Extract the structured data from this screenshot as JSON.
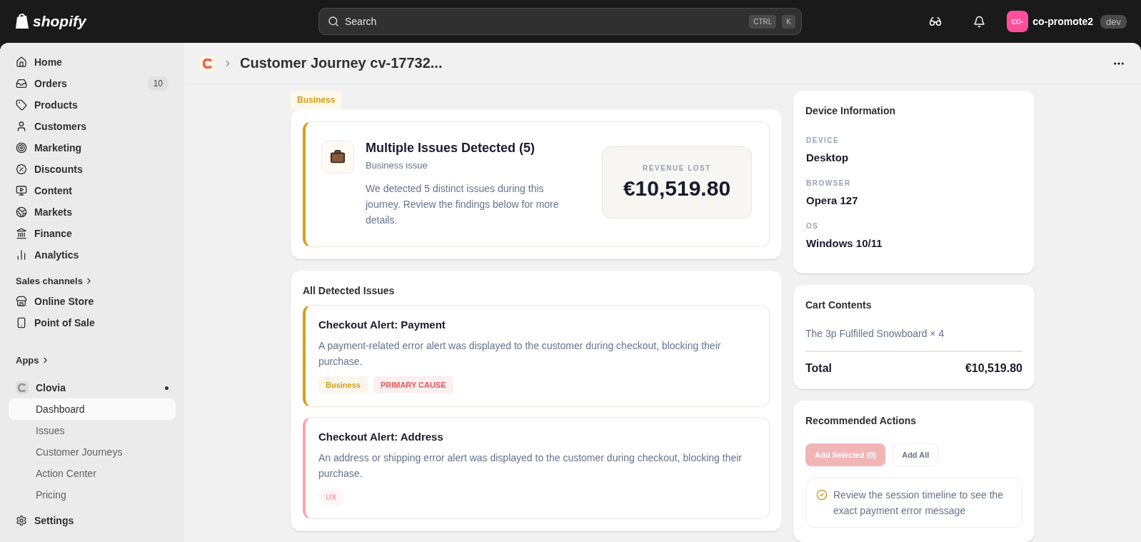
{
  "topbar": {
    "logo": "shopify",
    "search": {
      "placeholder": "Search",
      "keys": [
        "CTRL",
        "K"
      ]
    },
    "avatar": "co-",
    "store": "co-promote2",
    "env": "dev"
  },
  "sidebar": {
    "items": [
      {
        "label": "Home",
        "selected": false
      },
      {
        "label": "Orders",
        "badge": "10",
        "selected": false
      },
      {
        "label": "Products",
        "selected": false
      },
      {
        "label": "Customers",
        "selected": false
      },
      {
        "label": "Marketing",
        "selected": false
      },
      {
        "label": "Discounts",
        "selected": false
      },
      {
        "label": "Content",
        "selected": false
      },
      {
        "label": "Markets",
        "selected": false
      },
      {
        "label": "Finance",
        "selected": false
      },
      {
        "label": "Analytics",
        "selected": false
      }
    ],
    "sales_channels": {
      "heading": "Sales channels",
      "items": [
        {
          "label": "Online Store",
          "selected": false
        },
        {
          "label": "Point of Sale",
          "selected": false
        }
      ]
    },
    "apps": {
      "heading": "Apps",
      "app": {
        "label": "Clovia",
        "children": [
          {
            "label": "Dashboard",
            "selected": true
          },
          {
            "label": "Issues",
            "selected": false
          },
          {
            "label": "Customer Journeys",
            "selected": false
          },
          {
            "label": "Action Center",
            "selected": false
          },
          {
            "label": "Pricing",
            "selected": false
          }
        ]
      }
    },
    "settings": {
      "label": "Settings",
      "selected": false
    }
  },
  "page": {
    "title": "Customer Journey cv-17732..."
  },
  "summary": {
    "category": "Business",
    "color": "#d4a017",
    "title": "Multiple Issues Detected (5)",
    "subtitle": "Business issue",
    "text": "We detected 5 distinct issues during this journey. Review the findings below for more details.",
    "revenue_label": "REVENUE LOST",
    "revenue": "€10,519.80"
  },
  "issues": {
    "heading": "All Detected Issues",
    "items": [
      {
        "title": "Checkout Alert: Payment",
        "color": "#d4a017",
        "text": "A payment-related error alert was displayed to the customer during checkout, blocking their purchase.",
        "tags": [
          {
            "label": "Business",
            "color": "#d4a017"
          },
          {
            "label": "PRIMARY CAUSE",
            "color": "#e05a5a"
          }
        ]
      },
      {
        "title": "Checkout Alert: Address",
        "color": "#fca5a5",
        "text": "An address or shipping error alert was displayed to the customer during checkout, blocking their purchase.",
        "tags": [
          {
            "label": "UX",
            "color": "#fca5a5"
          }
        ]
      }
    ]
  },
  "device": {
    "heading": "Device Information",
    "fields": [
      {
        "label": "DEVICE",
        "value": "Desktop"
      },
      {
        "label": "BROWSER",
        "value": "Opera 127"
      },
      {
        "label": "OS",
        "value": "Windows 10/11"
      }
    ]
  },
  "cart": {
    "heading": "Cart Contents",
    "items": [
      "The 3p Fulfilled Snowboard × 4"
    ],
    "total_label": "Total",
    "total": "€10,519.80"
  },
  "actions": {
    "heading": "Recommended Actions",
    "buttons": [
      {
        "label": "Add Selected (0)",
        "kind": "primary",
        "disabled": true
      },
      {
        "label": "Add All",
        "kind": "secondary",
        "disabled": false
      }
    ],
    "items": [
      {
        "text": "Review the session timeline to see the exact payment error message"
      }
    ]
  }
}
